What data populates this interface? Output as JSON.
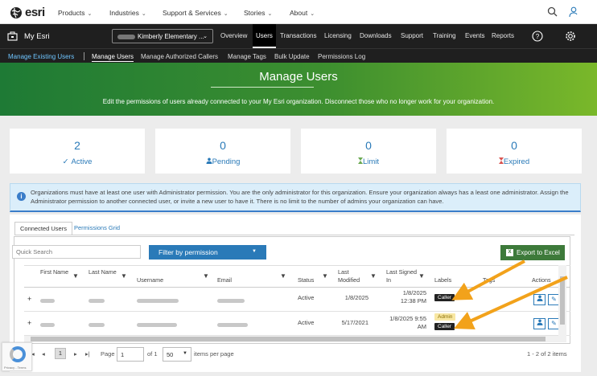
{
  "topnav": {
    "brand": "esri",
    "items": [
      {
        "label": "Products"
      },
      {
        "label": "Industries"
      },
      {
        "label": "Support & Services"
      },
      {
        "label": "Stories"
      },
      {
        "label": "About"
      }
    ]
  },
  "myesri_bar": {
    "title": "My Esri",
    "org_select": "Kimberly Elementary ...",
    "menu": [
      "Overview",
      "Users",
      "Transactions",
      "Licensing",
      "Downloads",
      "Support",
      "Training",
      "Events",
      "Reports"
    ],
    "active_menu": "Users"
  },
  "subnav": {
    "items": [
      "Manage Existing Users",
      "Manage Users",
      "Manage Authorized Callers",
      "Manage Tags",
      "Bulk Update",
      "Permissions Log"
    ],
    "active": "Manage Users"
  },
  "hero": {
    "title": "Manage Users",
    "description": "Edit the permissions of users already connected to your My Esri organization. Disconnect those who no longer work for your organization."
  },
  "stats": [
    {
      "value": "2",
      "label": "Active",
      "icon": "check-icon"
    },
    {
      "value": "0",
      "label": "Pending",
      "icon": "user-icon"
    },
    {
      "value": "0",
      "label": "Limit",
      "icon": "hourglass-icon"
    },
    {
      "value": "0",
      "label": "Expired",
      "icon": "hourglass-expired-icon"
    }
  ],
  "notice": {
    "text": "Organizations must have at least one user with Administrator permission. You are the only administrator for this organization. Ensure your organization always has a least one administrator. Assign the Administrator permission to another connected user, or invite a new user to have it. There is no limit to the number of admins your organization can have."
  },
  "tabs": [
    "Connected Users",
    "Permissions Grid"
  ],
  "toolbar": {
    "search_placeholder": "Quick Search",
    "filter_label": "Filter by permission",
    "export_label": "Export to Excel"
  },
  "table": {
    "columns": [
      "First Name",
      "Last Name",
      "Username",
      "Email",
      "Status",
      "Last Modified",
      "Last Signed In",
      "Labels",
      "Tags",
      "Actions"
    ],
    "rows": [
      {
        "status": "Active",
        "modified": "1/8/2025",
        "signed_in": "1/8/2025 12:38 PM",
        "labels": [
          "Caller"
        ]
      },
      {
        "status": "Active",
        "modified": "5/17/2021",
        "signed_in": "1/8/2025 9:55 AM",
        "labels": [
          "Admin",
          "Caller"
        ]
      }
    ]
  },
  "pager": {
    "current_page": "1",
    "of_label": "of 1",
    "page_label": "Page",
    "page_input": "1",
    "page_size": "50",
    "items_per_page_label": "items per page",
    "summary": "1 - 2 of 2 items"
  },
  "recaptcha": {
    "text": "Privacy - Terms"
  },
  "colors": {
    "accent": "#2a7ab8",
    "hero_start": "#1e7a35",
    "hero_end": "#7ab82a",
    "export_green": "#3d7a3a",
    "arrow": "#f2a21b"
  }
}
